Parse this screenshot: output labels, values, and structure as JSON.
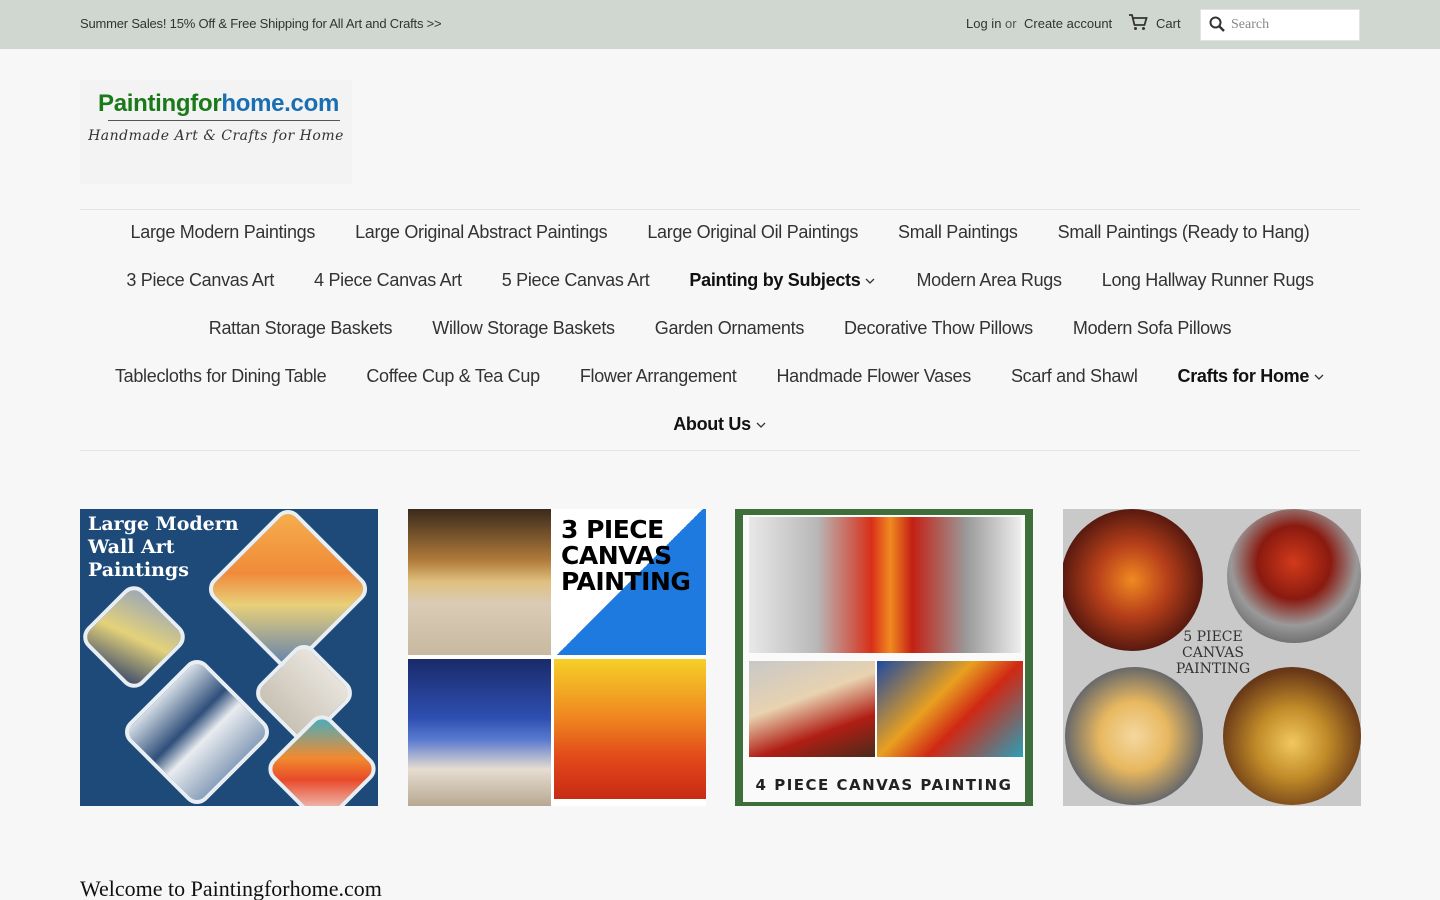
{
  "announcement": {
    "text": "Summer Sales! 15% Off & Free Shipping for All Art and Crafts >>"
  },
  "account": {
    "login": "Log in",
    "or": "or",
    "create": "Create account"
  },
  "cart": {
    "label": "Cart",
    "icon": "cart-icon"
  },
  "search": {
    "placeholder": "Search",
    "icon": "search-icon"
  },
  "logo": {
    "name_part1": "Paintingfor",
    "name_part2": "home.com",
    "tagline": "Handmade Art & Crafts for Home"
  },
  "nav": {
    "row1": [
      "Large Modern Paintings",
      "Large Original Abstract Paintings",
      "Large Original Oil Paintings",
      "Small Paintings",
      "Small Paintings (Ready to Hang)"
    ],
    "row2": [
      "3 Piece Canvas Art",
      "4 Piece Canvas Art",
      "5 Piece Canvas Art",
      "Painting by Subjects",
      "Modern Area Rugs",
      "Long Hallway Runner Rugs"
    ],
    "row3": [
      "Rattan Storage Baskets",
      "Willow Storage Baskets",
      "Garden Ornaments",
      "Decorative Thow Pillows",
      "Modern Sofa Pillows"
    ],
    "row4": [
      "Tablecloths for Dining Table",
      "Coffee Cup & Tea Cup",
      "Flower Arrangement",
      "Handmade Flower Vases",
      "Scarf and Shawl",
      "Crafts for Home"
    ],
    "row5": [
      "About Us"
    ]
  },
  "tiles": {
    "t1": "Large Modern\nWall Art\nPaintings",
    "t2": "3 PIECE\nCANVAS\nPAINTING",
    "t3": "4 PIECE CANVAS PAINTING",
    "t4": "5 PIECE\nCANVAS\nPAINTING"
  },
  "welcome": "Welcome to Paintingforhome.com",
  "colors": {
    "topbar": "#cfd7d0",
    "logo_green": "#1a7a1a",
    "logo_blue": "#1a6fb3",
    "tile1_bg": "#1e4a7a"
  }
}
